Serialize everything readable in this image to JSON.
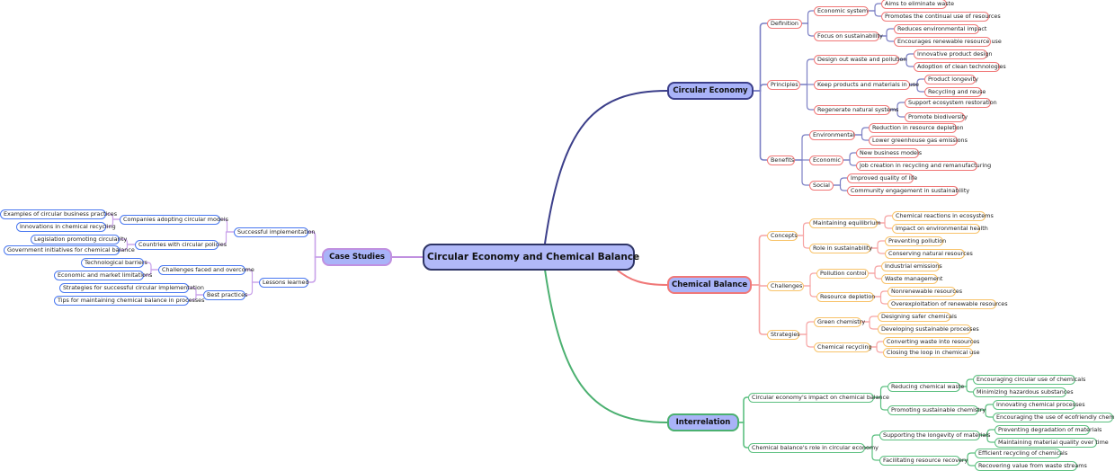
{
  "colors": {
    "circular_economy": {
      "line": "#7b7fc4",
      "border": "#f07878",
      "main_border": "#3c3f8a"
    },
    "chemical_balance": {
      "line": "#f6a4a4",
      "border": "#f8c36a",
      "main_border": "#f07878"
    },
    "interrelation": {
      "line": "#5cc080",
      "border": "#5cc080",
      "main_border": "#4bb070"
    },
    "case_studies": {
      "line": "#c9a2ea",
      "border": "#4a78f0",
      "main_border": "#c090e0"
    }
  },
  "mindmap": {
    "label": "Circular Economy and Chemical Balance",
    "children": [
      {
        "label": "Circular Economy",
        "children": [
          {
            "label": "Definition",
            "children": [
              {
                "label": "Economic system",
                "children": [
                  {
                    "label": "Aims to eliminate waste"
                  },
                  {
                    "label": "Promotes the continual use of resources"
                  }
                ]
              },
              {
                "label": "Focus on sustainability",
                "children": [
                  {
                    "label": "Reduces environmental impact"
                  },
                  {
                    "label": "Encourages renewable resource use"
                  }
                ]
              }
            ]
          },
          {
            "label": "Principles",
            "children": [
              {
                "label": "Design out waste and pollution",
                "children": [
                  {
                    "label": "Innovative product design"
                  },
                  {
                    "label": "Adoption of clean technologies"
                  }
                ]
              },
              {
                "label": "Keep products and materials in use",
                "children": [
                  {
                    "label": "Product longevity"
                  },
                  {
                    "label": "Recycling and reuse"
                  }
                ]
              },
              {
                "label": "Regenerate natural systems",
                "children": [
                  {
                    "label": "Support ecosystem restoration"
                  },
                  {
                    "label": "Promote biodiversity"
                  }
                ]
              }
            ]
          },
          {
            "label": "Benefits",
            "children": [
              {
                "label": "Environmental",
                "children": [
                  {
                    "label": "Reduction in resource depletion"
                  },
                  {
                    "label": "Lower greenhouse gas emissions"
                  }
                ]
              },
              {
                "label": "Economic",
                "children": [
                  {
                    "label": "New business models"
                  },
                  {
                    "label": "Job creation in recycling and remanufacturing"
                  }
                ]
              },
              {
                "label": "Social",
                "children": [
                  {
                    "label": "Improved quality of life"
                  },
                  {
                    "label": "Community engagement in sustainability"
                  }
                ]
              }
            ]
          }
        ]
      },
      {
        "label": "Chemical Balance",
        "children": [
          {
            "label": "Concepts",
            "children": [
              {
                "label": "Maintaining equilibrium",
                "children": [
                  {
                    "label": "Chemical reactions in ecosystems"
                  },
                  {
                    "label": "Impact on environmental health"
                  }
                ]
              },
              {
                "label": "Role in sustainability",
                "children": [
                  {
                    "label": "Preventing pollution"
                  },
                  {
                    "label": "Conserving natural resources"
                  }
                ]
              }
            ]
          },
          {
            "label": "Challenges",
            "children": [
              {
                "label": "Pollution control",
                "children": [
                  {
                    "label": "Industrial emissions"
                  },
                  {
                    "label": "Waste management"
                  }
                ]
              },
              {
                "label": "Resource depletion",
                "children": [
                  {
                    "label": "Nonrenewable resources"
                  },
                  {
                    "label": "Overexploitation of renewable resources"
                  }
                ]
              }
            ]
          },
          {
            "label": "Strategies",
            "children": [
              {
                "label": "Green chemistry",
                "children": [
                  {
                    "label": "Designing safer chemicals"
                  },
                  {
                    "label": "Developing sustainable processes"
                  }
                ]
              },
              {
                "label": "Chemical recycling",
                "children": [
                  {
                    "label": "Converting waste into resources"
                  },
                  {
                    "label": "Closing the loop in chemical use"
                  }
                ]
              }
            ]
          }
        ]
      },
      {
        "label": "Interrelation",
        "children": [
          {
            "label": "Circular economy's impact on chemical balance",
            "children": [
              {
                "label": "Reducing chemical waste",
                "children": [
                  {
                    "label": "Encouraging circular use of chemicals"
                  },
                  {
                    "label": "Minimizing hazardous substances"
                  }
                ]
              },
              {
                "label": "Promoting sustainable chemistry",
                "children": [
                  {
                    "label": "Innovating chemical processes"
                  },
                  {
                    "label": "Encouraging the use of ecofriendly chemicals"
                  }
                ]
              }
            ]
          },
          {
            "label": "Chemical balance's role in circular economy",
            "children": [
              {
                "label": "Supporting the longevity of materials",
                "children": [
                  {
                    "label": "Preventing degradation of materials"
                  },
                  {
                    "label": "Maintaining material quality over time"
                  }
                ]
              },
              {
                "label": "Facilitating resource recovery",
                "children": [
                  {
                    "label": "Efficient recycling of chemicals"
                  },
                  {
                    "label": "Recovering value from waste streams"
                  }
                ]
              }
            ]
          }
        ]
      },
      {
        "label": "Case Studies",
        "children": [
          {
            "label": "Successful implementation",
            "children": [
              {
                "label": "Companies adopting circular models",
                "children": [
                  {
                    "label": "Examples of circular business practices"
                  },
                  {
                    "label": "Innovations in chemical recycling"
                  }
                ]
              },
              {
                "label": "Countries with circular policies",
                "children": [
                  {
                    "label": "Legislation promoting circularity"
                  },
                  {
                    "label": "Government initiatives for chemical balance"
                  }
                ]
              }
            ]
          },
          {
            "label": "Lessons learned",
            "children": [
              {
                "label": "Challenges faced and overcome",
                "children": [
                  {
                    "label": "Technological barriers"
                  },
                  {
                    "label": "Economic and market limitations"
                  }
                ]
              },
              {
                "label": "Best practices",
                "children": [
                  {
                    "label": "Strategies for successful circular implementation"
                  },
                  {
                    "label": "Tips for maintaining chemical balance in processes"
                  }
                ]
              }
            ]
          }
        ]
      }
    ]
  }
}
